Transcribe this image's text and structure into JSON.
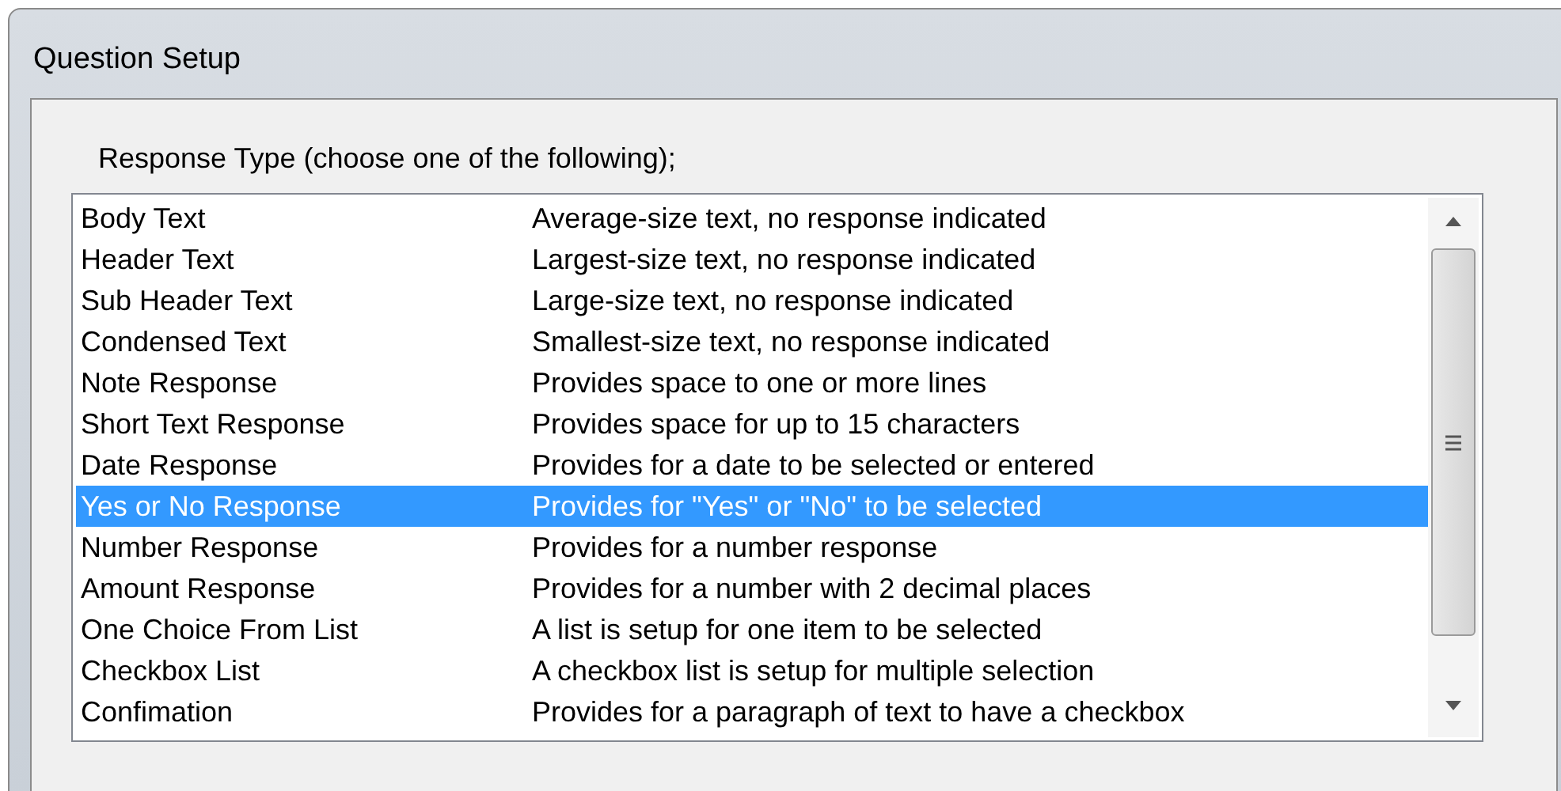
{
  "window": {
    "title": "Question Setup"
  },
  "response_type": {
    "label": "Response Type (choose one of the following);",
    "items": [
      {
        "name": "Body Text",
        "description": "Average-size text, no response indicated",
        "selected": false
      },
      {
        "name": "Header Text",
        "description": "Largest-size text, no response indicated",
        "selected": false
      },
      {
        "name": "Sub Header Text",
        "description": "Large-size text, no response indicated",
        "selected": false
      },
      {
        "name": "Condensed Text",
        "description": "Smallest-size text, no response indicated",
        "selected": false
      },
      {
        "name": "Note Response",
        "description": "Provides space to one or more lines",
        "selected": false
      },
      {
        "name": "Short Text Response",
        "description": "Provides space for up to 15 characters",
        "selected": false
      },
      {
        "name": "Date Response",
        "description": "Provides for a date to be selected or entered",
        "selected": false
      },
      {
        "name": "Yes or No Response",
        "description": "Provides for \"Yes\" or \"No\" to be selected",
        "selected": true
      },
      {
        "name": "Number Response",
        "description": "Provides for a number response",
        "selected": false
      },
      {
        "name": "Amount Response",
        "description": "Provides for a number with 2 decimal places",
        "selected": false
      },
      {
        "name": "One Choice From List",
        "description": "A list is setup for one item to be selected",
        "selected": false
      },
      {
        "name": "Checkbox List",
        "description": "A checkbox list is setup for multiple selection",
        "selected": false
      },
      {
        "name": "Confimation",
        "description": "Provides for a paragraph of text to have a checkbox",
        "selected": false
      }
    ]
  }
}
